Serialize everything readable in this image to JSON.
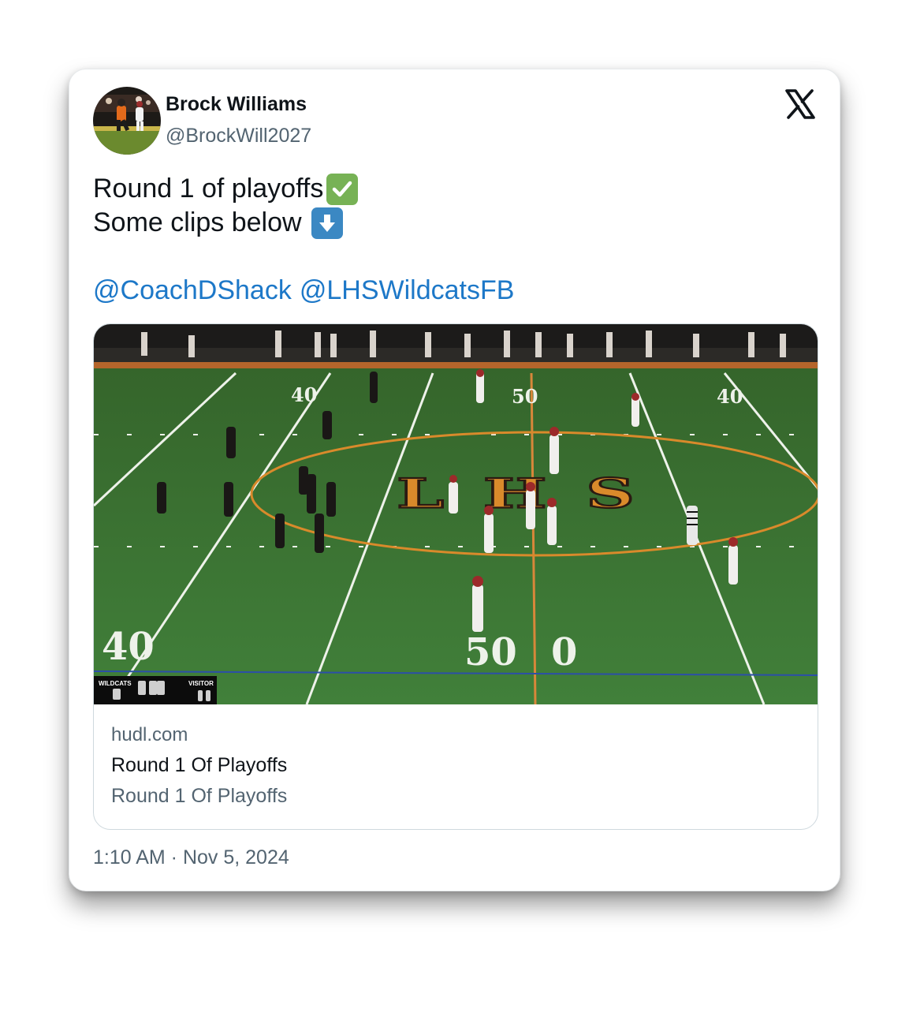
{
  "author": {
    "name": "Brock Williams",
    "handle": "@BrockWill2027"
  },
  "tweet": {
    "line1": "Round 1 of playoffs",
    "line1_emoji": "✅",
    "line2": "Some clips below",
    "line2_emoji": "⬇️",
    "mentions": [
      "@CoachDShack",
      "@LHSWildcatsFB"
    ]
  },
  "link_card": {
    "domain": "hudl.com",
    "title": "Round 1 Of Playoffs",
    "description": "Round 1 Of Playoffs",
    "media": {
      "field_logo": "LHS",
      "yard_numbers": [
        "40",
        "50",
        "40"
      ],
      "bottom_yard_numbers": [
        "40",
        "50",
        "0"
      ],
      "scoreboard": {
        "home": "WILDCATS",
        "visitor": "VISITOR"
      }
    }
  },
  "timestamp": "1:10 AM · Nov 5, 2024",
  "icons": {
    "platform": "x-logo-icon",
    "check": "check-mark-icon",
    "down_arrow": "down-arrow-icon"
  },
  "colors": {
    "mention": "#1d78c8",
    "secondary_text": "#536471",
    "field_green": "#3f7a34",
    "logo_orange": "#d98a2b"
  }
}
